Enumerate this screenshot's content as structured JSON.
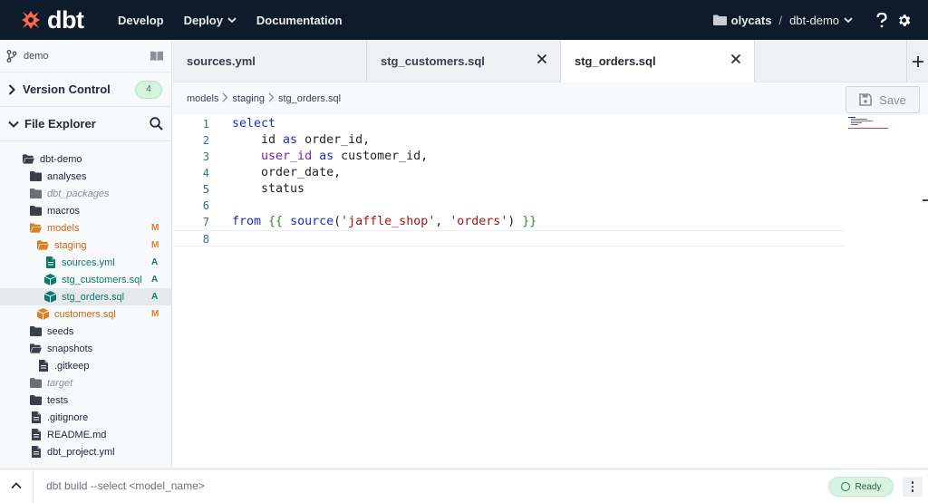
{
  "app": {
    "logo_text": "dbt"
  },
  "topnav": {
    "items": [
      {
        "label": "Develop"
      },
      {
        "label": "Deploy"
      },
      {
        "label": "Documentation"
      }
    ],
    "account": "olycats",
    "separator": "/",
    "project": "dbt-demo"
  },
  "sidebar": {
    "branch": "demo",
    "version_control": {
      "label": "Version Control",
      "count": "4"
    },
    "file_explorer": {
      "label": "File Explorer"
    },
    "tree": [
      {
        "name": "dbt-demo",
        "type": "folder-open",
        "status": ""
      },
      {
        "name": "analyses",
        "type": "folder",
        "status": ""
      },
      {
        "name": "dbt_packages",
        "type": "folder",
        "status": ""
      },
      {
        "name": "macros",
        "type": "folder",
        "status": ""
      },
      {
        "name": "models",
        "type": "folder-open",
        "status": "M"
      },
      {
        "name": "staging",
        "type": "folder-open",
        "status": "M"
      },
      {
        "name": "sources.yml",
        "type": "file",
        "status": "A"
      },
      {
        "name": "stg_customers.sql",
        "type": "model",
        "status": "A"
      },
      {
        "name": "stg_orders.sql",
        "type": "model",
        "status": "A"
      },
      {
        "name": "customers.sql",
        "type": "model",
        "status": "M"
      },
      {
        "name": "seeds",
        "type": "folder",
        "status": ""
      },
      {
        "name": "snapshots",
        "type": "folder-open",
        "status": ""
      },
      {
        "name": ".gitkeep",
        "type": "file",
        "status": ""
      },
      {
        "name": "target",
        "type": "folder",
        "status": ""
      },
      {
        "name": "tests",
        "type": "folder",
        "status": ""
      },
      {
        "name": ".gitignore",
        "type": "file",
        "status": ""
      },
      {
        "name": "README.md",
        "type": "file",
        "status": ""
      },
      {
        "name": "dbt_project.yml",
        "type": "file",
        "status": ""
      }
    ]
  },
  "tabs": [
    {
      "label": "sources.yml",
      "active": false
    },
    {
      "label": "stg_customers.sql",
      "active": false
    },
    {
      "label": "stg_orders.sql",
      "active": true
    }
  ],
  "breadcrumb": [
    "models",
    "staging",
    "stg_orders.sql"
  ],
  "editor": {
    "save_label": "Save",
    "lines": [
      {
        "n": "1",
        "parts": [
          [
            "kw",
            "select"
          ]
        ]
      },
      {
        "n": "2",
        "parts": [
          [
            "",
            "    id "
          ],
          [
            "kw",
            "as"
          ],
          [
            "",
            " order_id,"
          ]
        ]
      },
      {
        "n": "3",
        "parts": [
          [
            "",
            "    "
          ],
          [
            "fn",
            "user_id"
          ],
          [
            "",
            " "
          ],
          [
            "kw",
            "as"
          ],
          [
            "",
            " customer_id,"
          ]
        ]
      },
      {
        "n": "4",
        "parts": [
          [
            "",
            "    order_date,"
          ]
        ]
      },
      {
        "n": "5",
        "parts": [
          [
            "",
            "    status"
          ]
        ]
      },
      {
        "n": "6",
        "parts": []
      },
      {
        "n": "7",
        "parts": [
          [
            "kw",
            "from"
          ],
          [
            "",
            " "
          ],
          [
            "brace",
            "{{"
          ],
          [
            "",
            " "
          ],
          [
            "kw",
            "source"
          ],
          [
            "",
            "("
          ],
          [
            "str",
            "'jaffle_shop'"
          ],
          [
            "",
            ", "
          ],
          [
            "str",
            "'orders'"
          ],
          [
            "",
            ") "
          ],
          [
            "brace",
            "}}"
          ]
        ]
      },
      {
        "n": "8",
        "parts": []
      }
    ]
  },
  "command_bar": {
    "placeholder": "dbt build --select <model_name>",
    "status": "Ready"
  },
  "colors": {
    "topbar": "#0e1b2a",
    "brand": "#ff694a",
    "modified": "#d9822b",
    "added": "#0b7a6b",
    "ready_bg": "#d8f3e1"
  }
}
